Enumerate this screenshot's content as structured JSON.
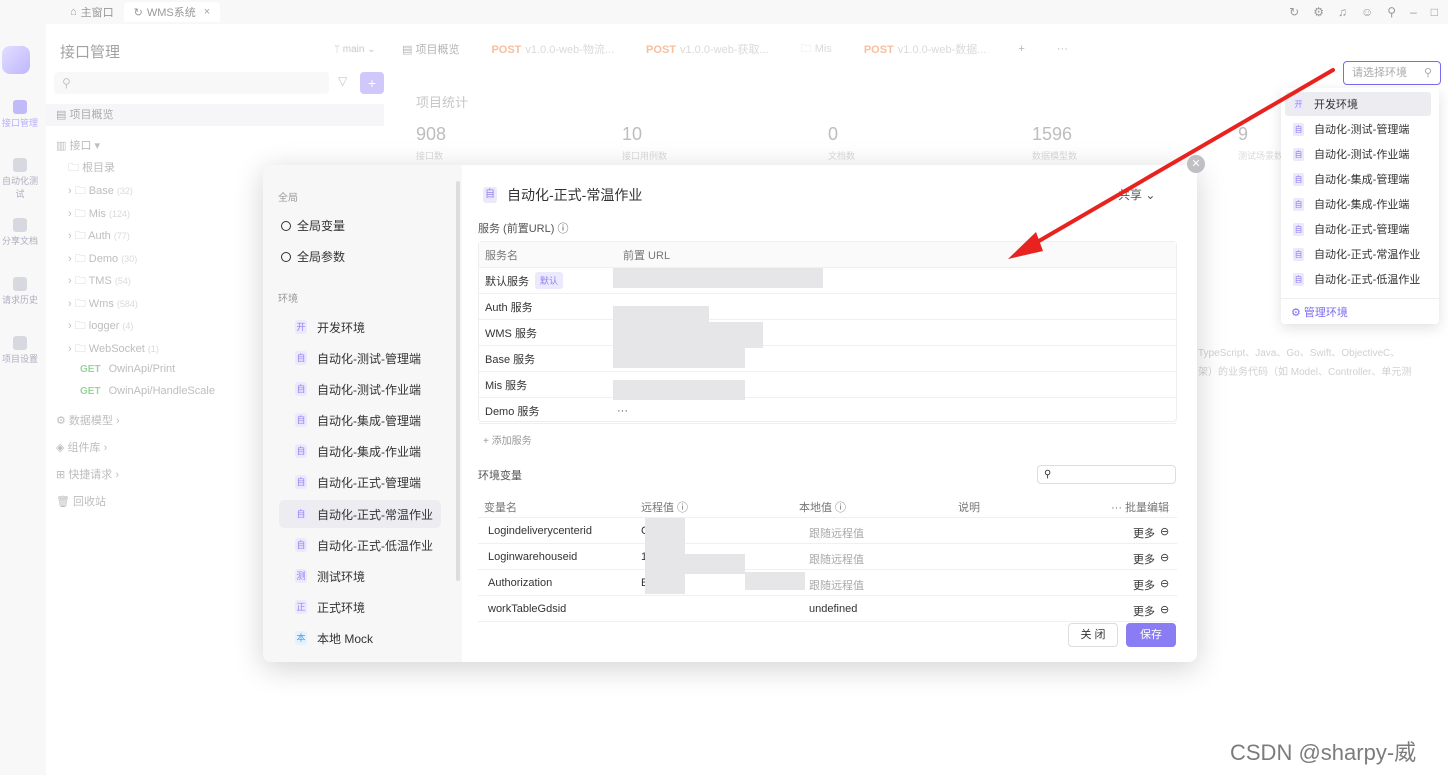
{
  "topbar": {
    "home_tab": "主窗口",
    "app_tab": "WMS系统",
    "close": "×"
  },
  "rail": {
    "items": [
      "接口管理",
      "自动化测试",
      "分享文档",
      "请求历史",
      "项目设置"
    ]
  },
  "tree": {
    "title": "接口管理",
    "branch": "main",
    "overview": "项目概览",
    "api_root": "接口",
    "root_dir": "根目录",
    "folders": [
      {
        "name": "Base",
        "count": "(32)"
      },
      {
        "name": "Mis",
        "count": "(124)"
      },
      {
        "name": "Auth",
        "count": "(77)"
      },
      {
        "name": "Demo",
        "count": "(30)"
      },
      {
        "name": "TMS",
        "count": "(54)"
      },
      {
        "name": "Wms",
        "count": "(584)"
      },
      {
        "name": "logger",
        "count": "(4)"
      },
      {
        "name": "WebSocket",
        "count": "(1)"
      }
    ],
    "get_items": [
      {
        "method": "GET",
        "path": "OwinApi/Print"
      },
      {
        "method": "GET",
        "path": "OwinApi/HandleScale"
      }
    ],
    "sections": [
      "数据模型",
      "组件库",
      "快捷请求",
      "回收站"
    ]
  },
  "main": {
    "tabs": [
      {
        "method": "",
        "label": "项目概览"
      },
      {
        "method": "POST",
        "label": "v1.0.0-web-物流..."
      },
      {
        "method": "POST",
        "label": "v1.0.0-web-获取..."
      },
      {
        "method": "",
        "label": "Mis"
      },
      {
        "method": "POST",
        "label": "v1.0.0-web-数据..."
      }
    ],
    "stats_title": "项目统计",
    "stats": [
      {
        "num": "908",
        "label": "接口数"
      },
      {
        "num": "10",
        "label": "接口用例数"
      },
      {
        "num": "0",
        "label": "文档数"
      },
      {
        "num": "1596",
        "label": "数据模型数"
      },
      {
        "num": "9",
        "label": "测试场景数"
      }
    ],
    "desc_line1": "TypeScript、Java、Go、Swift、ObjectiveC、",
    "desc_line2": "架）的业务代码（如 Model、Controller、单元测"
  },
  "modal": {
    "global_section": "全局",
    "global_vars": "全局变量",
    "global_params": "全局参数",
    "env_section": "环境",
    "envs": [
      {
        "badge": "开",
        "label": "开发环境"
      },
      {
        "badge": "自",
        "label": "自动化-测试-管理端"
      },
      {
        "badge": "自",
        "label": "自动化-测试-作业端"
      },
      {
        "badge": "自",
        "label": "自动化-集成-管理端"
      },
      {
        "badge": "自",
        "label": "自动化-集成-作业端"
      },
      {
        "badge": "自",
        "label": "自动化-正式-管理端"
      },
      {
        "badge": "自",
        "label": "自动化-正式-常温作业"
      },
      {
        "badge": "自",
        "label": "自动化-正式-低温作业"
      },
      {
        "badge": "测",
        "label": "测试环境"
      },
      {
        "badge": "正",
        "label": "正式环境"
      },
      {
        "badge": "本",
        "label": "本地 Mock"
      }
    ],
    "title_badge": "自",
    "title": "自动化-正式-常温作业",
    "share": "共享",
    "services_section": "服务 (前置URL)",
    "service_headers": [
      "服务名",
      "前置 URL"
    ],
    "services": [
      {
        "name": "默认服务",
        "tag": "默认"
      },
      {
        "name": "Auth 服务",
        "tag": ""
      },
      {
        "name": "WMS 服务",
        "tag": ""
      },
      {
        "name": "Base 服务",
        "tag": ""
      },
      {
        "name": "Mis 服务",
        "tag": ""
      },
      {
        "name": "Demo 服务",
        "tag": ""
      }
    ],
    "add_service": "+ 添加服务",
    "vars_section": "环境变量",
    "var_headers": {
      "name": "变量名",
      "remote": "远程值",
      "local": "本地值",
      "desc": "说明",
      "batch": "批量编辑"
    },
    "vars": [
      {
        "name": "Logindeliverycenterid",
        "remote": "C",
        "local": "跟随远程值",
        "more": "更多"
      },
      {
        "name": "Loginwarehouseid",
        "remote": "1",
        "local": "跟随远程值",
        "more": "更多"
      },
      {
        "name": "Authorization",
        "remote": "E",
        "local": "跟随远程值",
        "more": "更多"
      },
      {
        "name": "workTableGdsid",
        "remote": "",
        "local": "undefined",
        "more": "更多"
      }
    ],
    "close_btn": "关 闭",
    "save_btn": "保存"
  },
  "dropdown": {
    "placeholder": "请选择环境",
    "items": [
      {
        "badge": "开",
        "label": "开发环境"
      },
      {
        "badge": "自",
        "label": "自动化-测试-管理端"
      },
      {
        "badge": "自",
        "label": "自动化-测试-作业端"
      },
      {
        "badge": "自",
        "label": "自动化-集成-管理端"
      },
      {
        "badge": "自",
        "label": "自动化-集成-作业端"
      },
      {
        "badge": "自",
        "label": "自动化-正式-管理端"
      },
      {
        "badge": "自",
        "label": "自动化-正式-常温作业"
      },
      {
        "badge": "自",
        "label": "自动化-正式-低温作业"
      }
    ],
    "manage": "管理环境"
  },
  "watermark": "CSDN @sharpy-威",
  "colors": {
    "accent": "#8a7cf2",
    "post": "#f08a4b",
    "get": "#4caf50",
    "arrow": "#e8231f"
  }
}
